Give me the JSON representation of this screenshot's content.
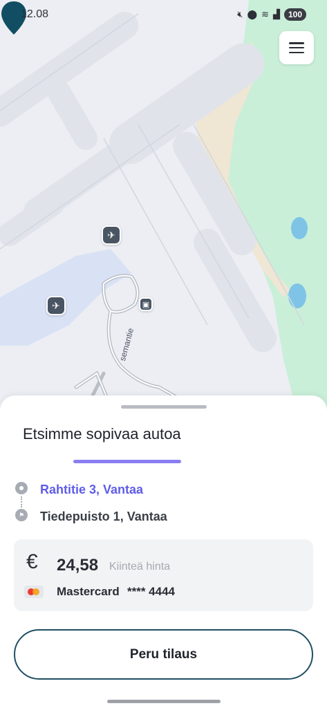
{
  "status_bar": {
    "time": "12.08",
    "battery": "100",
    "icons": [
      "mute-icon",
      "location-icon",
      "wifi-icon",
      "signal-icon"
    ]
  },
  "map": {
    "road_label": "semantie",
    "markers": [
      "airport-icon",
      "airport-icon",
      "train-icon",
      "location-pin-icon"
    ],
    "colors": {
      "water": "#7fc4e6",
      "park": "#c9efd9",
      "sand": "#efe6d3",
      "pin": "#124e63"
    }
  },
  "menu": {
    "icon": "hamburger-menu-icon"
  },
  "sheet": {
    "title": "Etsimme sopivaa autoa",
    "route": {
      "start": "Rahtitie 3, Vantaa",
      "end": "Tiedepuisto 1, Vantaa"
    },
    "payment": {
      "currency_symbol": "€",
      "price": "24,58",
      "price_type": "Kiinteä hinta",
      "card_brand": "Mastercard",
      "card_number": "**** 4444"
    },
    "cancel_label": "Peru tilaus"
  },
  "colors": {
    "accent": "#5f5ce8",
    "progress": "#8a7ef2",
    "button_border": "#1e4e62"
  }
}
